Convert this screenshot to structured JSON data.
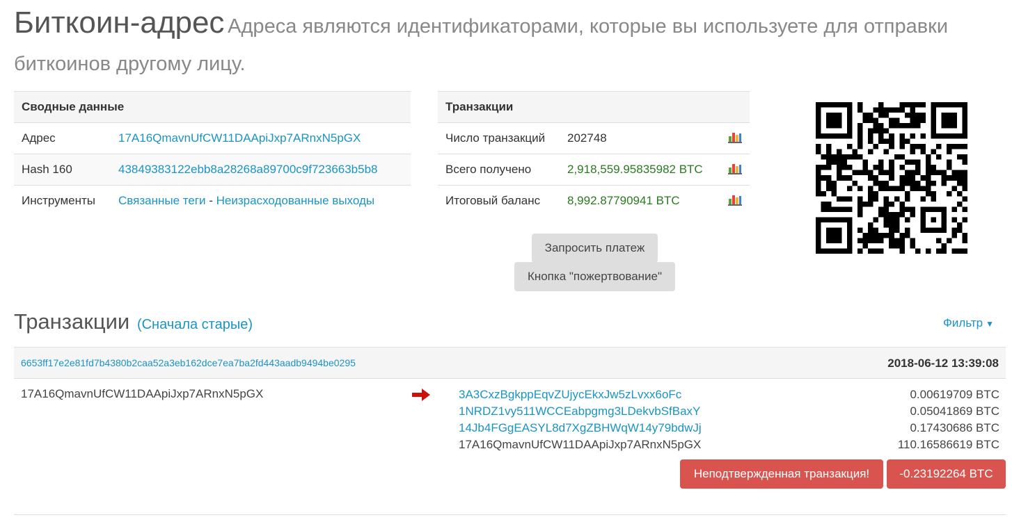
{
  "header": {
    "title": "Биткоин-адрес",
    "subtitle": "Адреса являются идентификаторами, которые вы используете для отправки биткоинов другому лицу."
  },
  "summary": {
    "heading": "Сводные данные",
    "address_label": "Адрес",
    "address_value": "17A16QmavnUfCW11DAApiJxp7ARnxN5pGX",
    "hash_label": "Hash 160",
    "hash_value": "43849383122ebb8a28268a89700c9f723663b5b8",
    "tools_label": "Инструменты",
    "tools_link1": "Связанные теги",
    "tools_sep": "-",
    "tools_link2": "Неизрасходованные выходы"
  },
  "transactions_summary": {
    "heading": "Транзакции",
    "count_label": "Число транзакций",
    "count_value": "202748",
    "received_label": "Всего получено",
    "received_value": "2,918,559.95835982 BTC",
    "balance_label": "Итоговый баланс",
    "balance_value": "8,992.87790941 BTC",
    "chart_icon": "bar-chart-icon"
  },
  "buttons": {
    "request_payment": "Запросить платеж",
    "donation_button": "Кнопка \"пожертвование\""
  },
  "tx_list": {
    "heading": "Транзакции",
    "order": "(Сначала старые)",
    "filter": "Фильтр",
    "caret_icon": "caret-down-icon",
    "items": [
      {
        "hash": "6653ff17e2e81fd7b4380b2caa52a3eb162dce7ea7ba2fd443aadb9494be0295",
        "time": "2018-06-12 13:39:08",
        "from": "17A16QmavnUfCW11DAApiJxp7ARnxN5pGX",
        "outputs": [
          {
            "address": "3A3CxzBgkppEqvZUjycEkxJw5zLvxx6oFc",
            "amount": "0.00619709 BTC"
          },
          {
            "address": "1NRDZ1vy511WCCEabpgmg3LDekvbSfBaxY",
            "amount": "0.05041869 BTC"
          },
          {
            "address": "14Jb4FGgEASYL8d7XgZBHWqW14y79bdwJj",
            "amount": "0.17430686 BTC"
          },
          {
            "address": "17A16QmavnUfCW11DAApiJxp7ARnxN5pGX",
            "amount": "110.16586619 BTC"
          }
        ],
        "status": "Неподтвержденная транзакция!",
        "total": "-0.23192264 BTC"
      }
    ]
  },
  "colors": {
    "link": "#1a94c4",
    "green": "#2a7a1f",
    "danger": "#d9534f",
    "arrow": "#c8140c"
  }
}
